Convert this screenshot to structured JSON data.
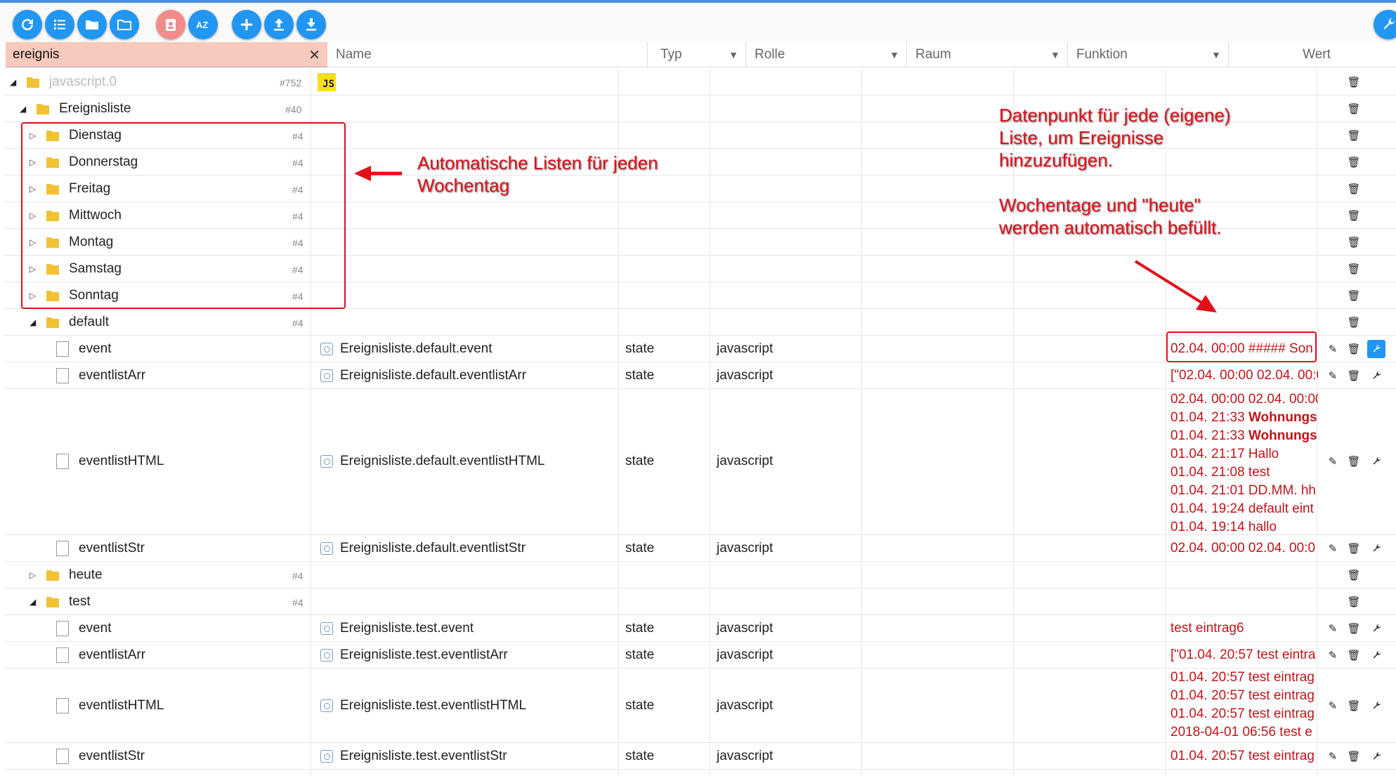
{
  "search": {
    "value": "ereignis"
  },
  "columns": {
    "name": "Name",
    "typ": "Typ",
    "rolle": "Rolle",
    "raum": "Raum",
    "funktion": "Funktion",
    "wert": "Wert"
  },
  "colors": {
    "accent": "#2196f3",
    "value": "#c0141a",
    "annotation": "#e0101a",
    "search_bg": "#f8c9bd"
  },
  "tree": {
    "root": {
      "label": "javascript.0",
      "count": "#752"
    },
    "ereignisliste": {
      "label": "Ereignisliste",
      "count": "#40"
    },
    "days": [
      {
        "label": "Dienstag",
        "count": "#4"
      },
      {
        "label": "Donnerstag",
        "count": "#4"
      },
      {
        "label": "Freitag",
        "count": "#4"
      },
      {
        "label": "Mittwoch",
        "count": "#4"
      },
      {
        "label": "Montag",
        "count": "#4"
      },
      {
        "label": "Samstag",
        "count": "#4"
      },
      {
        "label": "Sonntag",
        "count": "#4"
      }
    ],
    "default": {
      "label": "default",
      "count": "#4"
    },
    "heute": {
      "label": "heute",
      "count": "#4"
    },
    "test": {
      "label": "test",
      "count": "#4"
    }
  },
  "states": {
    "default_event": {
      "name": "event",
      "id": "Ereignisliste.default.event",
      "typ": "state",
      "rolle": "javascript",
      "wert": "02.04. 00:00 ##### Son"
    },
    "default_arr": {
      "name": "eventlistArr",
      "id": "Ereignisliste.default.eventlistArr",
      "typ": "state",
      "rolle": "javascript",
      "wert": "[\"02.04. 00:00 02.04. 00:0"
    },
    "default_html": {
      "name": "eventlistHTML",
      "id": "Ereignisliste.default.eventlistHTML",
      "typ": "state",
      "rolle": "javascript",
      "lines": [
        {
          "text": "02.04. 00:00 02.04. 00:00",
          "bold": ""
        },
        {
          "text": "01.04. 21:33 ",
          "bold": "Wohnungs"
        },
        {
          "text": "01.04. 21:33 ",
          "bold": "Wohnungs"
        },
        {
          "text": "01.04. 21:17 Hallo",
          "bold": ""
        },
        {
          "text": "01.04. 21:08 test",
          "bold": ""
        },
        {
          "text": "01.04. 21:01 DD.MM. hh",
          "bold": ""
        },
        {
          "text": "01.04. 19:24 default eint",
          "bold": ""
        },
        {
          "text": "01.04. 19:14 hallo",
          "bold": ""
        }
      ]
    },
    "default_str": {
      "name": "eventlistStr",
      "id": "Ereignisliste.default.eventlistStr",
      "typ": "state",
      "rolle": "javascript",
      "wert": "02.04. 00:00 02.04. 00:0"
    },
    "test_event": {
      "name": "event",
      "id": "Ereignisliste.test.event",
      "typ": "state",
      "rolle": "javascript",
      "wert": "test eintrag6"
    },
    "test_arr": {
      "name": "eventlistArr",
      "id": "Ereignisliste.test.eventlistArr",
      "typ": "state",
      "rolle": "javascript",
      "wert": "[\"01.04. 20:57 test eintra"
    },
    "test_html": {
      "name": "eventlistHTML",
      "id": "Ereignisliste.test.eventlistHTML",
      "typ": "state",
      "rolle": "javascript",
      "lines": [
        {
          "text": "01.04. 20:57 test eintrag"
        },
        {
          "text": "01.04. 20:57 test eintrag"
        },
        {
          "text": "01.04. 20:57 test eintrag"
        },
        {
          "text": "2018-04-01 06:56 test e"
        }
      ]
    },
    "test_str": {
      "name": "eventlistStr",
      "id": "Ereignisliste.test.eventlistStr",
      "typ": "state",
      "rolle": "javascript",
      "wert": "01.04. 20:57 test eintrag"
    }
  },
  "annotations": {
    "left_1": "Automatische Listen für jeden",
    "left_2": "Wochentag",
    "right_1": "Datenpunkt für jede (eigene)",
    "right_2": "Liste, um Ereignisse",
    "right_3": "hinzuzufügen.",
    "right_4": "Wochentage und \"heute\"",
    "right_5": "werden automatisch befüllt."
  },
  "js_badge": "JS"
}
